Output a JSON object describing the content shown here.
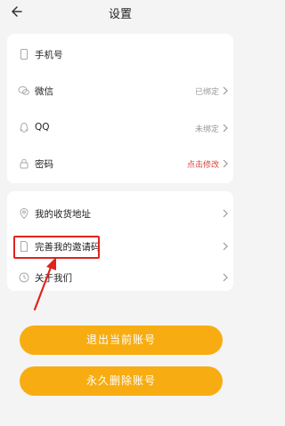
{
  "header": {
    "title": "设置",
    "back_icon": "back-arrow-icon"
  },
  "account_section": {
    "items": [
      {
        "label": "手机号",
        "value": "",
        "icon": "phone-icon"
      },
      {
        "label": "微信",
        "value": "已绑定",
        "icon": "wechat-icon"
      },
      {
        "label": "QQ",
        "value": "未绑定",
        "icon": "qq-icon"
      },
      {
        "label": "密码",
        "value": "点击修改",
        "value_color": "#d8443a",
        "icon": "lock-icon"
      }
    ]
  },
  "more_section": {
    "items": [
      {
        "label": "我的收货地址",
        "icon": "location-icon"
      },
      {
        "label": "完善我的邀请码",
        "icon": "document-icon"
      },
      {
        "label": "关于我们",
        "icon": "clock-icon"
      }
    ]
  },
  "buttons": {
    "logout": "退出当前账号",
    "delete": "永久删除账号"
  },
  "colors": {
    "accent": "#f7ad12",
    "highlight": "#e0231d",
    "background": "#f4f4f4"
  }
}
